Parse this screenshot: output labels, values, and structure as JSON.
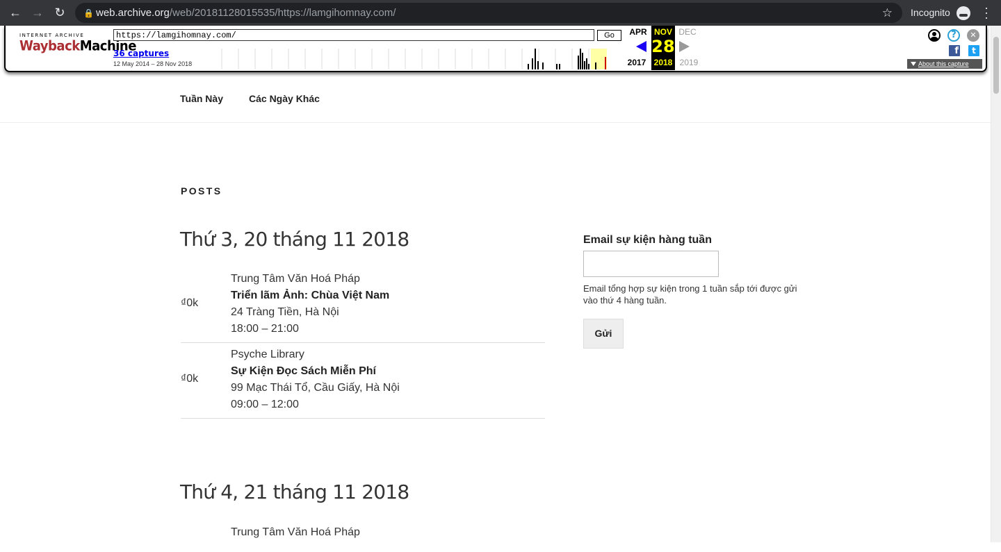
{
  "browser": {
    "url_host": "web.archive.org",
    "url_rest": "/web/20181128015535/https://lamgihomnay.com/",
    "incognito_label": "Incognito"
  },
  "wayback": {
    "logo_top": "INTERNET ARCHIVE",
    "logo_main_a": "Wayback",
    "logo_main_b": "Machine",
    "url_value": "https://lamgihomnay.com/",
    "go_label": "Go",
    "captures_label": "36 captures",
    "date_range": "12 May 2014 – 28 Nov 2018",
    "prev_month": "APR",
    "prev_year": "2017",
    "current_month": "NOV",
    "current_day": "28",
    "current_year": "2018",
    "next_month": "DEC",
    "next_year": "2019",
    "about_label": "About this capture",
    "help_glyph": "?",
    "close_glyph": "✕",
    "facebook_glyph": "f",
    "twitter_glyph": "t"
  },
  "site_nav": {
    "items": [
      {
        "label": "Tuần Này"
      },
      {
        "label": "Các Ngày Khác"
      }
    ]
  },
  "main": {
    "posts_label": "POSTS",
    "days": [
      {
        "title": "Thứ 3, 20 tháng 11 2018",
        "events": [
          {
            "price": "₫0k",
            "venue": "Trung Tâm Văn Hoá Pháp",
            "name": "Triển lãm Ảnh: Chùa Việt Nam",
            "address": "24 Tràng Tiền, Hà Nội",
            "time": "18:00 – 21:00"
          },
          {
            "price": "₫0k",
            "venue": "Psyche Library",
            "name": "Sự Kiện Đọc Sách Miễn Phí",
            "address": "99 Mạc Thái Tổ, Cầu Giấy, Hà Nội",
            "time": "09:00 – 12:00"
          }
        ]
      },
      {
        "title": "Thứ 4, 21 tháng 11 2018",
        "events": [
          {
            "venue": "Trung Tâm Văn Hoá Pháp"
          }
        ]
      }
    ]
  },
  "sidebar": {
    "widget_title": "Email sự kiện hàng tuần",
    "email_placeholder": "",
    "note": "Email tổng hợp sự kiện trong 1 tuần sắp tới được gửi vào thứ 4 hàng tuần.",
    "send_label": "Gửi"
  }
}
